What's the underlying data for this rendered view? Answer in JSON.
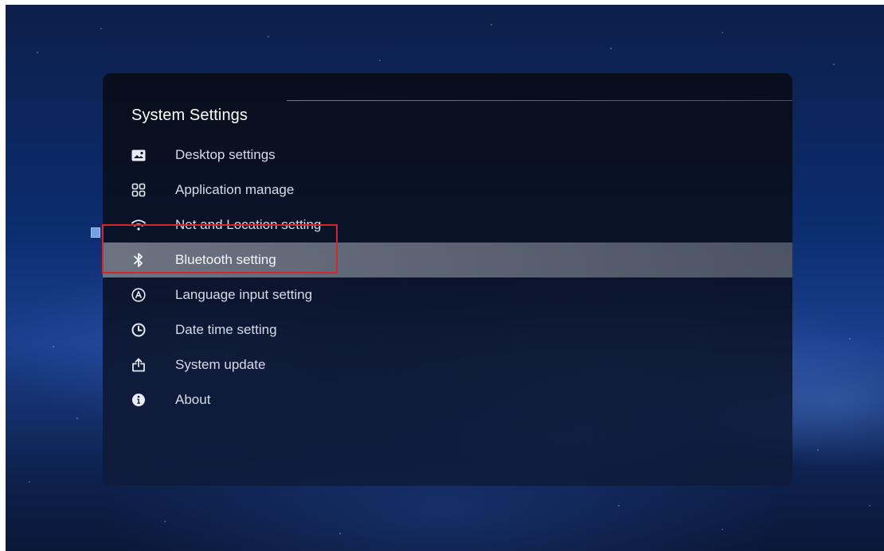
{
  "settings": {
    "title": "System Settings",
    "items": [
      {
        "label": "Desktop settings",
        "icon": "desktop-image-icon"
      },
      {
        "label": "Application manage",
        "icon": "grid-apps-icon"
      },
      {
        "label": "Net and Location setting",
        "icon": "wifi-icon"
      },
      {
        "label": "Bluetooth setting",
        "icon": "bluetooth-icon",
        "selected": true
      },
      {
        "label": "Language input setting",
        "icon": "language-a-icon"
      },
      {
        "label": "Date time setting",
        "icon": "clock-icon"
      },
      {
        "label": "System update",
        "icon": "upload-icon"
      },
      {
        "label": "About",
        "icon": "info-icon"
      }
    ]
  },
  "colors": {
    "highlight_border": "#d6252b",
    "focus_marker": "#6fa0e8",
    "selected_row": "#96999f"
  }
}
